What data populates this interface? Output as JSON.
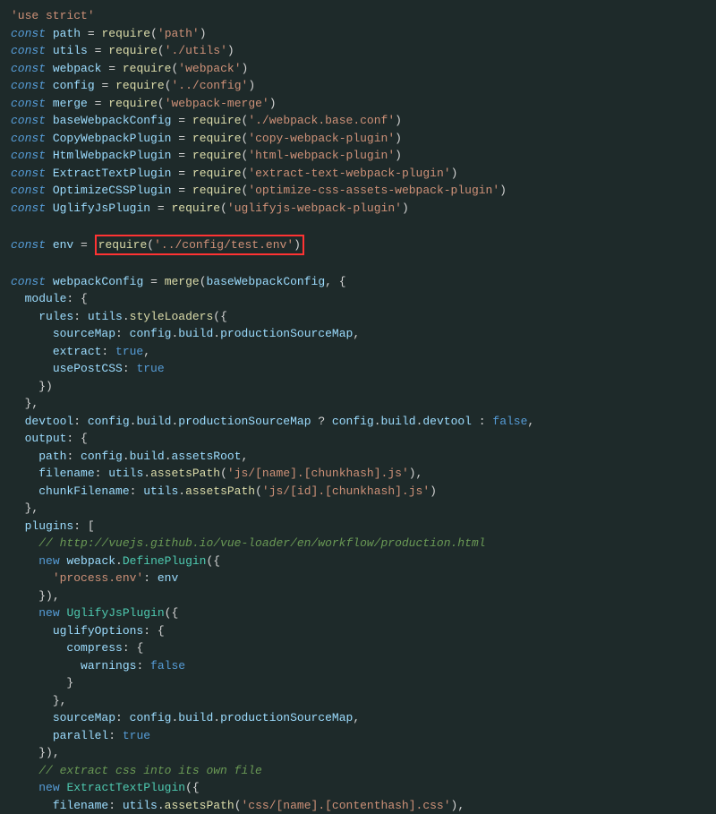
{
  "code": {
    "useStrict": "'use strict'",
    "const": "const",
    "path": "path",
    "utils": "utils",
    "webpack": "webpack",
    "config": "config",
    "merge": "merge",
    "baseWebpackConfig": "baseWebpackConfig",
    "CopyWebpackPlugin": "CopyWebpackPlugin",
    "HtmlWebpackPlugin": "HtmlWebpackPlugin",
    "ExtractTextPlugin": "ExtractTextPlugin",
    "OptimizeCSSPlugin": "OptimizeCSSPlugin",
    "UglifyJsPlugin": "UglifyJsPlugin",
    "env": "env",
    "webpackConfig": "webpackConfig",
    "require": "require",
    "reqPath": "'path'",
    "reqUtils": "'./utils'",
    "reqWebpack": "'webpack'",
    "reqConfig": "'../config'",
    "reqMerge": "'webpack-merge'",
    "reqBase": "'./webpack.base.conf'",
    "reqCopy": "'copy-webpack-plugin'",
    "reqHtml": "'html-webpack-plugin'",
    "reqExtract": "'extract-text-webpack-plugin'",
    "reqOptimize": "'optimize-css-assets-webpack-plugin'",
    "reqUglify": "'uglifyjs-webpack-plugin'",
    "reqTestEnv": "'../config/test.env'",
    "module": "module",
    "rules": "rules",
    "styleLoaders": "styleLoaders",
    "sourceMap": "sourceMap",
    "build": "build",
    "productionSourceMap": "productionSourceMap",
    "extract": "extract",
    "usePostCSS": "usePostCSS",
    "true": "true",
    "false": "false",
    "devtool": "devtool",
    "devtoolProp": "devtool",
    "output": "output",
    "pathProp": "path",
    "assetsRoot": "assetsRoot",
    "filename": "filename",
    "assetsPath": "assetsPath",
    "jsName": "'js/[name].[chunkhash].js'",
    "chunkFilename": "chunkFilename",
    "jsId": "'js/[id].[chunkhash].js'",
    "plugins": "plugins",
    "comment1": "// http://vuejs.github.io/vue-loader/en/workflow/production.html",
    "new": "new",
    "DefinePlugin": "DefinePlugin",
    "processEnv": "'process.env'",
    "uglifyOptions": "uglifyOptions",
    "compress": "compress",
    "warnings": "warnings",
    "parallel": "parallel",
    "comment2": "// extract css into its own file",
    "cssName": "'css/[name].[contenthash].css'"
  }
}
